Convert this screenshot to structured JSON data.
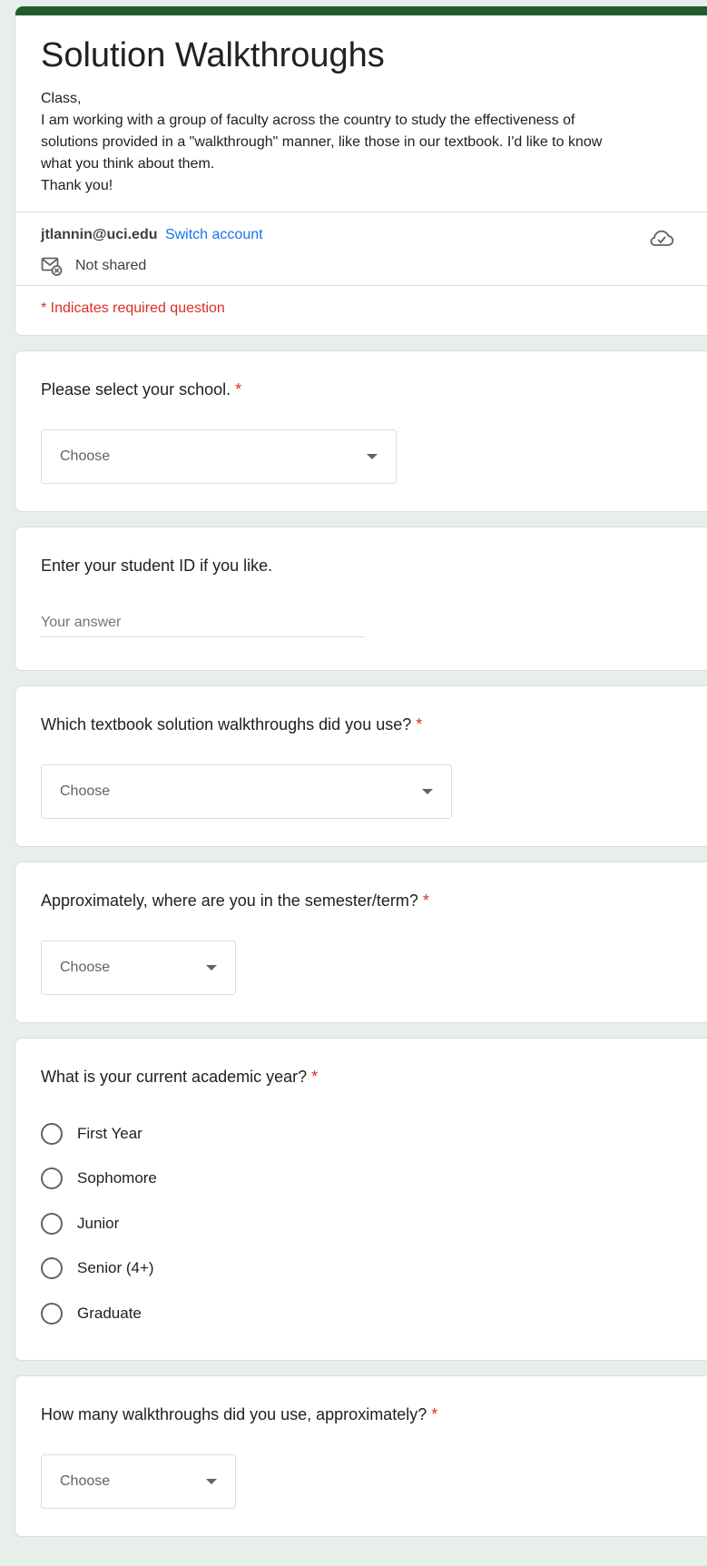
{
  "form": {
    "title": "Solution Walkthroughs",
    "description": [
      "Class,",
      "I am working with a group of faculty across the country to study the effectiveness of",
      "solutions provided in a \"walkthrough\" manner, like those in our textbook. I'd like to know",
      "what you think about them.",
      "Thank you!"
    ],
    "accent_color": "#1e5d2a"
  },
  "account": {
    "email": "jtlannin@uci.edu",
    "switch_label": "Switch account",
    "shared_status": "Not shared"
  },
  "required_note": "* Indicates required question",
  "questions": {
    "school": {
      "title": "Please select your school.",
      "required_mark": "*",
      "dropdown_value": "Choose"
    },
    "student_id": {
      "title": "Enter your student ID if you like.",
      "placeholder": "Your answer"
    },
    "walkthroughs": {
      "title": "Which textbook solution walkthroughs did you use?",
      "required_mark": "*",
      "dropdown_value": "Choose"
    },
    "semester": {
      "title": "Approximately, where are you in the semester/term?",
      "required_mark": "*",
      "dropdown_value": "Choose"
    },
    "academic_year": {
      "title": "What is your current academic year?",
      "required_mark": "*",
      "options": [
        "First Year",
        "Sophomore",
        "Junior",
        "Senior (4+)",
        "Graduate"
      ]
    },
    "how_many": {
      "title": "How many walkthroughs did you use, approximately?",
      "required_mark": "*",
      "dropdown_value": "Choose"
    }
  }
}
